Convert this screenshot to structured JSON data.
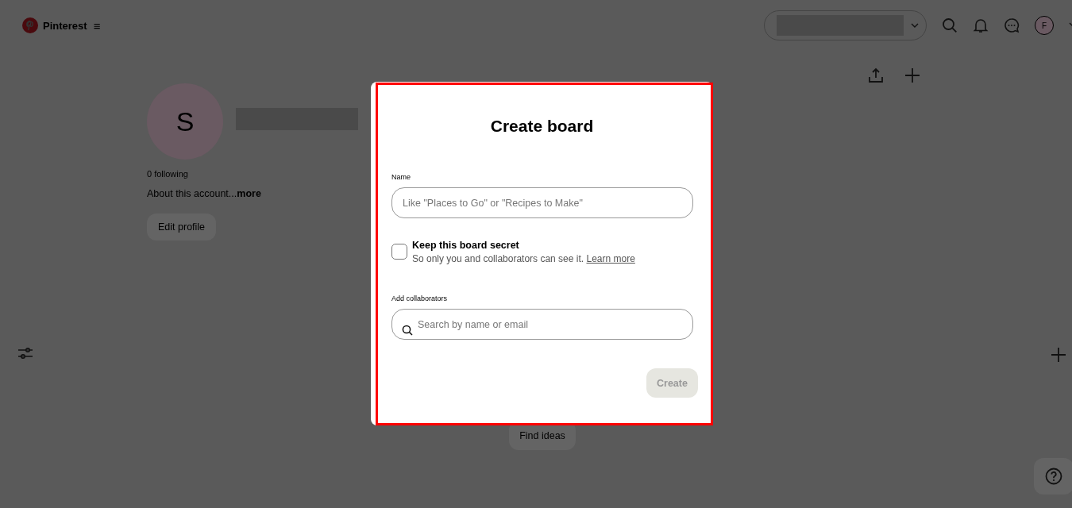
{
  "header": {
    "brand": "Pinterest",
    "menu_glyph": "≡",
    "avatar_letter": "F"
  },
  "profile": {
    "avatar_letter": "S",
    "following": "0 following",
    "about": "About this account...",
    "more": "more",
    "edit_button": "Edit profile"
  },
  "find_ideas": "Find ideas",
  "modal": {
    "title": "Create board",
    "name_label": "Name",
    "name_placeholder": "Like \"Places to Go\" or \"Recipes to Make\"",
    "secret": {
      "label": "Keep this board secret",
      "description": "So only you and collaborators can see it.",
      "link": "Learn more",
      "checked": false
    },
    "collaborators_label": "Add collaborators",
    "search_placeholder": "Search by name or email",
    "create_button": {
      "label": "Create",
      "disabled": true
    }
  }
}
